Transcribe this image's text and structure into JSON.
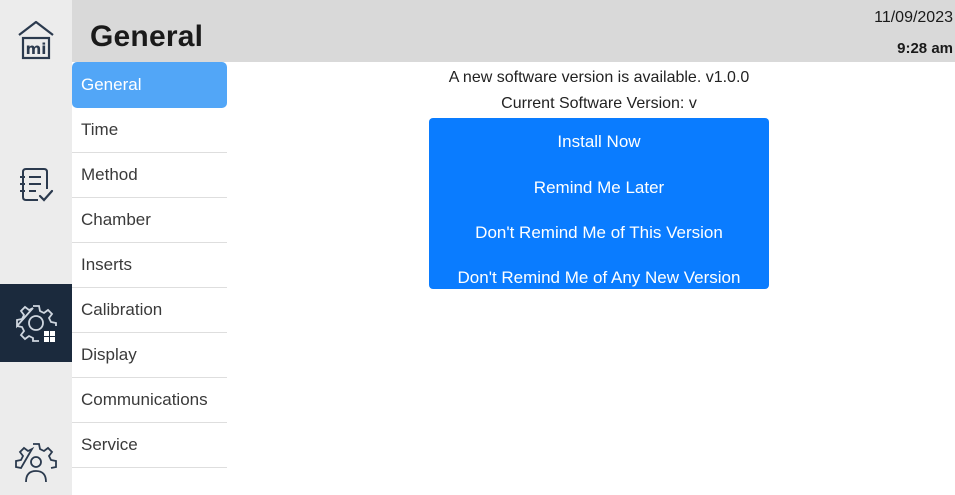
{
  "header": {
    "title": "General",
    "date": "11/09/2023",
    "time": "9:28 am"
  },
  "rail": {
    "home_icon": "home-mi-icon",
    "methods_icon": "clipboard-check-icon",
    "settings_icon": "gear-grid-icon",
    "service_icon": "gear-person-icon",
    "active": "settings"
  },
  "menu": {
    "items": [
      {
        "label": "General",
        "active": true
      },
      {
        "label": "Time"
      },
      {
        "label": "Method"
      },
      {
        "label": "Chamber"
      },
      {
        "label": "Inserts"
      },
      {
        "label": "Calibration"
      },
      {
        "label": "Display"
      },
      {
        "label": "Communications"
      },
      {
        "label": "Service"
      }
    ]
  },
  "update": {
    "message": "A new software version is available. v1.0.0",
    "current_version": "Current Software Version: v",
    "buttons": {
      "install": "Install Now",
      "remind_later": "Remind Me Later",
      "skip_version": "Don't Remind Me of This Version",
      "never_remind": "Don't Remind Me of Any New Version"
    }
  },
  "colors": {
    "header_bg": "#d9d9d9",
    "rail_bg": "#ececec",
    "rail_active_bg": "#1b2a3d",
    "menu_active_bg": "#52a6f7",
    "button_bg": "#0a7cff"
  }
}
